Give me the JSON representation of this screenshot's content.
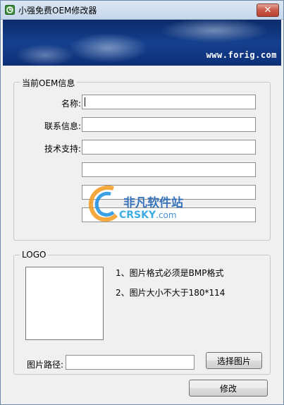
{
  "window": {
    "title": "小强免费OEM修改器",
    "close_symbol": "✕"
  },
  "banner": {
    "url_text": "www.forig.com"
  },
  "oem_group": {
    "legend": "当前OEM信息",
    "name_label": "名称:",
    "contact_label": "联系信息:",
    "support_label": "技术支持:",
    "name_value": "",
    "contact_value": "",
    "support_lines": [
      "",
      "",
      "",
      ""
    ]
  },
  "logo_group": {
    "legend": "LOGO",
    "note1": "1、图片格式必须是BMP格式",
    "note2": "2、图片大小不大于180*114",
    "path_label": "图片路径:",
    "path_value": "",
    "choose_button": "选择图片"
  },
  "modify_button": "修改",
  "watermark": {
    "line1": "非凡软件站",
    "line2": "CRSKY",
    "line2_suffix": ".com"
  },
  "colors": {
    "banner_blue": "#0b2a6a",
    "close_red": "#c75a4a",
    "accent_text": "#1a5fb4"
  }
}
